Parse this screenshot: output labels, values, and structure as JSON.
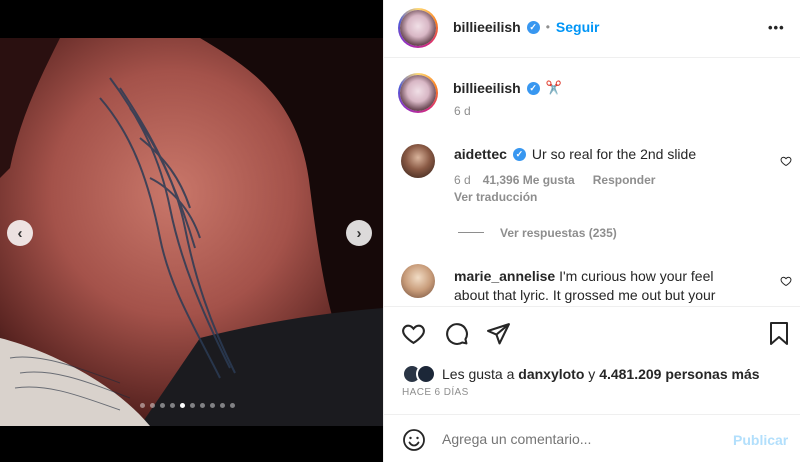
{
  "post": {
    "username": "billieeilish",
    "follow_label": "Seguir",
    "more_label": "•••",
    "separator": "•"
  },
  "caption": {
    "username": "billieeilish",
    "emoji": "✂️",
    "time": "6 d"
  },
  "comments": [
    {
      "username": "aidettec",
      "text": "Ur so real for the 2nd slide",
      "time": "6 d",
      "likes": "41,396 Me gusta",
      "reply_label": "Responder",
      "translate_label": "Ver traducción",
      "replies_label": "Ver respuestas (235)"
    },
    {
      "username": "marie_annelise",
      "text_line1": "I'm curious how your feel",
      "text_line2": "about that lyric. It grossed me out but your"
    }
  ],
  "likes": {
    "prefix": "Les gusta a",
    "user": "danxyloto",
    "conj": "y",
    "rest": "4.481.209 personas más"
  },
  "posted_time": "HACE 6 DÍAS",
  "composer": {
    "placeholder": "Agrega un comentario...",
    "publish_label": "Publicar"
  },
  "media": {
    "slide_count": 10,
    "active_slide": 4
  },
  "colors": {
    "accent": "#0095f6",
    "verified": "#3897f0",
    "text": "#262626",
    "muted": "#8e8e8e"
  }
}
